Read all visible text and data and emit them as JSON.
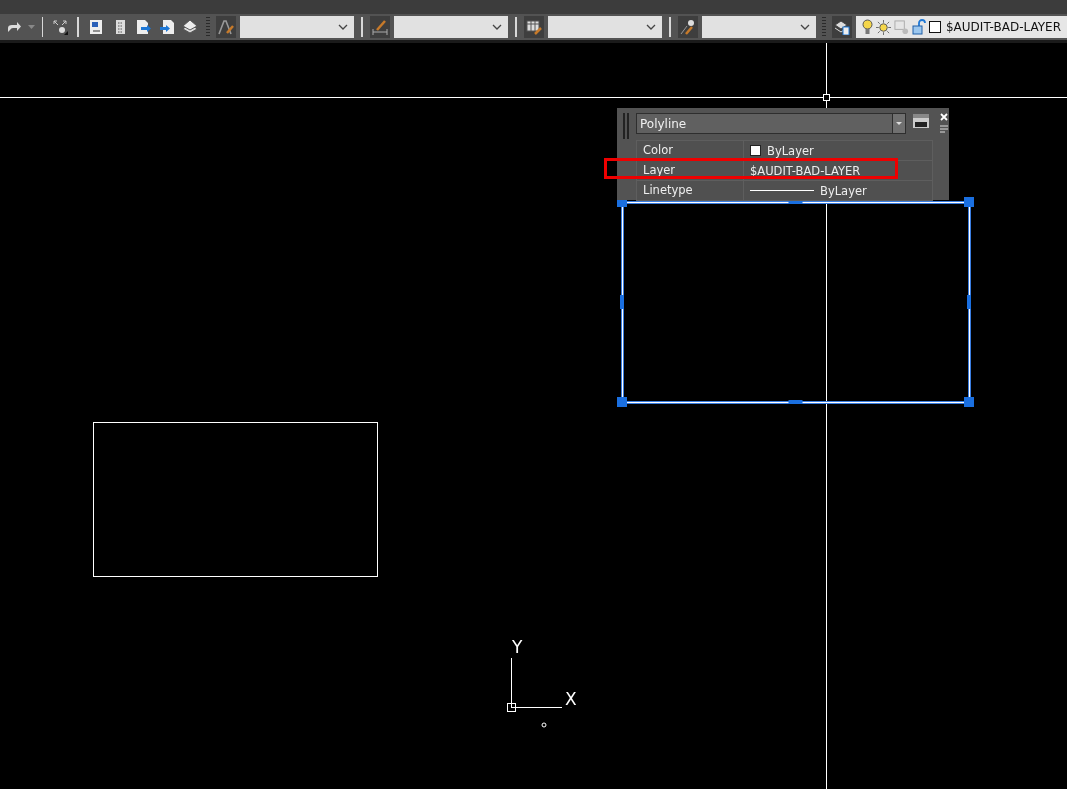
{
  "toolbar": {
    "layer_name": "$AUDIT-BAD-LAYER"
  },
  "quick_properties": {
    "object_type": "Polyline",
    "rows": [
      {
        "label": "Color",
        "value": "ByLayer",
        "kind": "color",
        "highlighted": false
      },
      {
        "label": "Layer",
        "value": "$AUDIT-BAD-LAYER",
        "kind": "text",
        "highlighted": true
      },
      {
        "label": "Linetype",
        "value": "ByLayer",
        "kind": "linetype",
        "highlighted": false
      }
    ]
  },
  "objects": [
    {
      "kind": "rectangle",
      "selected": true
    },
    {
      "kind": "rectangle",
      "selected": false
    }
  ],
  "ucs": {
    "x_label": "X",
    "y_label": "Y"
  }
}
